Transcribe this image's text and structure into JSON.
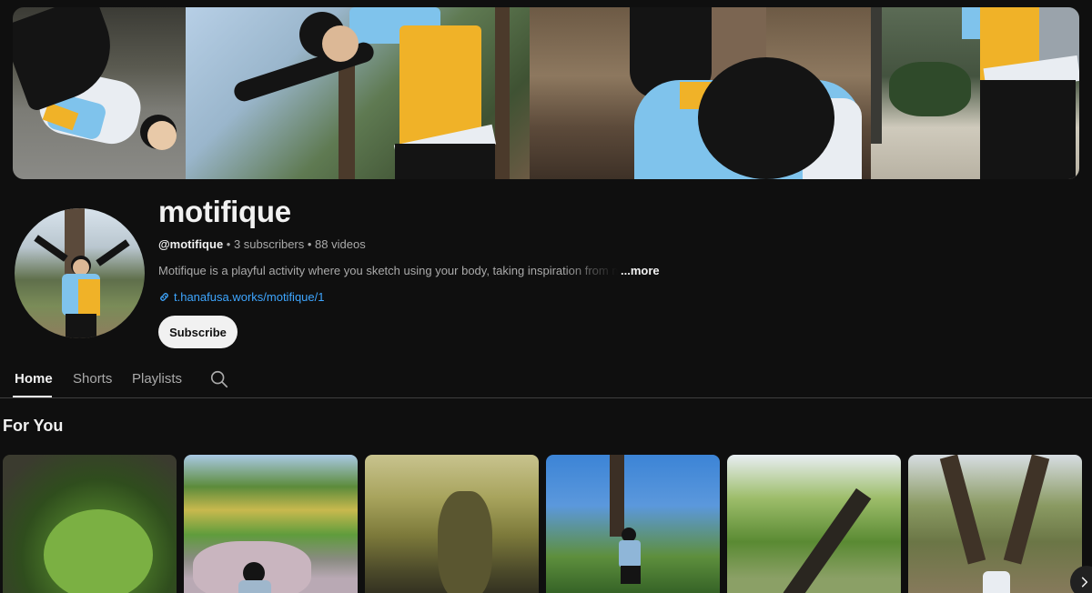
{
  "channel": {
    "name": "motifique",
    "handle": "@motifique",
    "subscribers": "3 subscribers",
    "videos": "88 videos",
    "separator": " • ",
    "description": "Motifique is a playful activity where you sketch using your body, taking inspiration from motifs in nature and the city around you.",
    "more_label": "...more",
    "link": "t.hanafusa.works/motifique/1",
    "subscribe_label": "Subscribe"
  },
  "tabs": [
    {
      "label": "Home",
      "active": true
    },
    {
      "label": "Shorts",
      "active": false
    },
    {
      "label": "Playlists",
      "active": false
    }
  ],
  "section": {
    "title": "For You"
  },
  "icons": {
    "search": "search-icon",
    "link": "link-icon",
    "next": "chevron-right-icon"
  },
  "colors": {
    "background": "#0f0f0f",
    "text": "#f1f1f1",
    "secondary_text": "#aaaaaa",
    "link": "#3ea6ff",
    "subscribe_bg": "#f1f1f1"
  }
}
